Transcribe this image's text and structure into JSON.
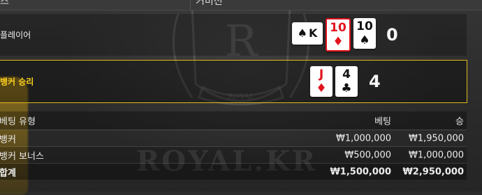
{
  "header": {
    "left_label": "즈",
    "right_label": "커미션"
  },
  "player": {
    "label": "플레이어",
    "score": "0",
    "cards": [
      {
        "rank": "K",
        "suit": "♠",
        "color": "#111111",
        "sideways": true
      },
      {
        "rank": "10",
        "suit": "♦",
        "color": "#e2131d",
        "sideways": false
      },
      {
        "rank": "10",
        "suit": "♠",
        "color": "#111111",
        "sideways": false
      }
    ]
  },
  "banker": {
    "label": "뱅커 승리",
    "score": "4",
    "highlight_color": "#e2b91b",
    "cards": [
      {
        "rank": "J",
        "suit": "♦",
        "color": "#e2131d"
      },
      {
        "rank": "4",
        "suit": "♣",
        "color": "#111111"
      }
    ]
  },
  "bets_table": {
    "columns": [
      "베팅 유형",
      "베팅",
      "승"
    ],
    "rows": [
      {
        "type": "뱅커",
        "bet": "₩1,000,000",
        "win": "₩1,950,000"
      },
      {
        "type": "뱅커 보너스",
        "bet": "₩500,000",
        "win": "₩1,000,000"
      }
    ],
    "total": {
      "type": "합계",
      "bet": "₩1,500,000",
      "win": "₩2,950,000"
    }
  },
  "watermark": {
    "text": "ROYAL.KR",
    "crest_letter": "R",
    "crest_ribbon": "ROYAL"
  }
}
